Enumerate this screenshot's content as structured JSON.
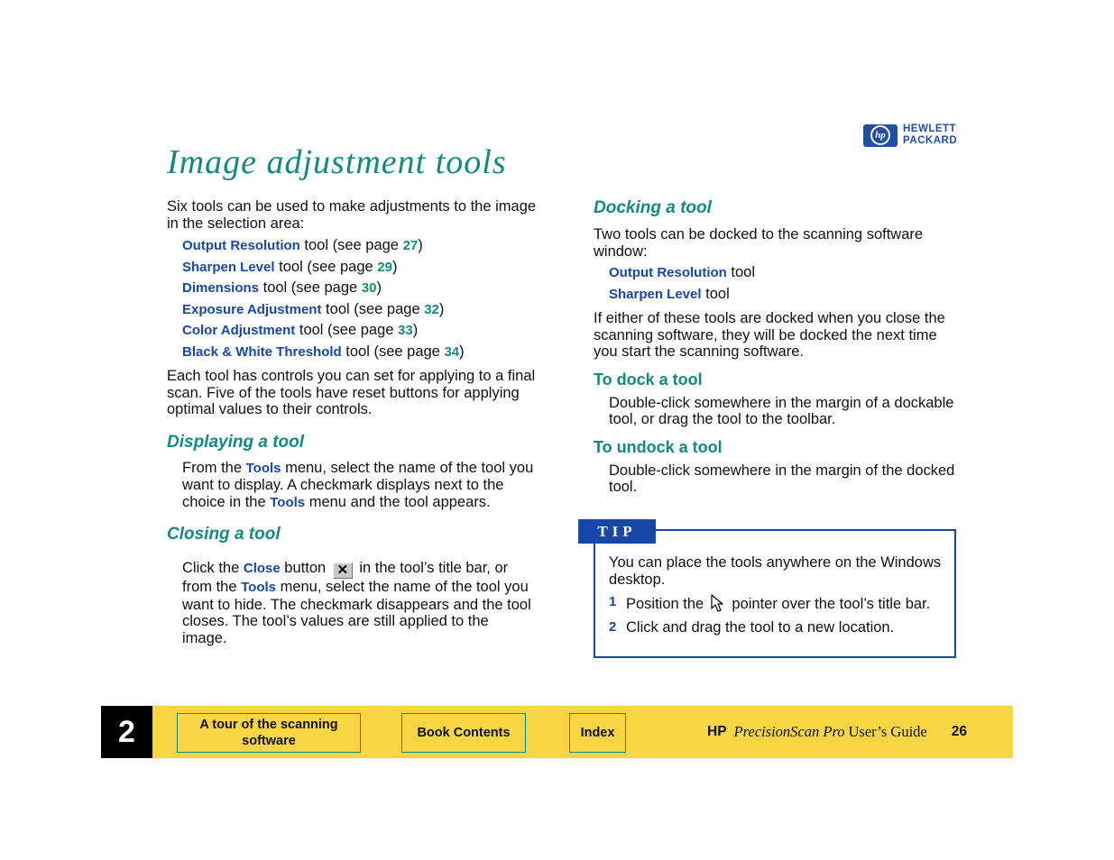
{
  "logo": {
    "mark": "hp",
    "line1": "HEWLETT",
    "line2": "PACKARD",
    "brand_color": "#1e50a8"
  },
  "title": "Image adjustment tools",
  "colors": {
    "heading": "#138a80",
    "link": "#1847a8",
    "footer_bg": "#f7d543",
    "tip_blue": "#1847a8"
  },
  "left": {
    "intro": "Six tools can be used to make adjustments to the image in the selection area:",
    "tools": [
      {
        "name": "Output Resolution",
        "mid": " tool (see page ",
        "page": "27",
        "end": ")"
      },
      {
        "name": "Sharpen Level",
        "mid": " tool (see page ",
        "page": "29",
        "end": ")"
      },
      {
        "name": "Dimensions",
        "mid": " tool (see page ",
        "page": "30",
        "end": ")"
      },
      {
        "name": "Exposure Adjustment",
        "mid": " tool (see page ",
        "page": "32",
        "end": ")"
      },
      {
        "name": "Color Adjustment",
        "mid": " tool (see page ",
        "page": "33",
        "end": ")"
      },
      {
        "name": "Black & White Threshold",
        "mid": " tool (see page ",
        "page": "34",
        "end": ")"
      }
    ],
    "controls_para": "Each tool has controls you can set for applying to a final scan. Five of the tools have reset buttons for applying optimal values to their controls.",
    "displaying": {
      "heading": "Displaying a tool",
      "t1": "From the ",
      "link1": "Tools",
      "t2": " menu, select the name of the tool you want to display. A checkmark displays next to the choice in the ",
      "link2": "Tools",
      "t3": " menu and the tool appears."
    },
    "closing": {
      "heading": "Closing a tool",
      "t1": "Click the ",
      "link1": "Close",
      "t2": " button ",
      "close_glyph": "✕",
      "t3": " in the tool’s title bar, or from the ",
      "link2": "Tools",
      "t4": " menu, select the name of the tool you want to hide. The checkmark disappears and the tool closes. The tool’s values are still applied to the image."
    }
  },
  "right": {
    "docking": {
      "heading": "Docking a tool",
      "intro": "Two tools can be docked to the scanning software window:",
      "tools": [
        {
          "name": "Output Resolution",
          "suffix": " tool"
        },
        {
          "name": "Sharpen Level",
          "suffix": " tool"
        }
      ],
      "para": "If either of these tools are docked when you close the scanning software, they will be docked the next time you start the scanning software."
    },
    "dock": {
      "heading": "To dock a tool",
      "text": "Double-click somewhere in the margin of a dockable tool, or drag the tool to the toolbar."
    },
    "undock": {
      "heading": "To undock a tool",
      "text": "Double-click somewhere in the margin of the docked tool."
    },
    "tip": {
      "label": "TIP",
      "intro": "You can place the tools anywhere on the Windows desktop.",
      "steps": [
        {
          "num": "1",
          "t1": "Position the ",
          "t2": " pointer over the tool’s title bar."
        },
        {
          "num": "2",
          "t1": "Click and drag the tool to a new location.",
          "t2": ""
        }
      ]
    }
  },
  "footer": {
    "chapter": "2",
    "buttons": [
      "A tour of the scanning software",
      "Book Contents",
      "Index"
    ],
    "hp": "HP",
    "product": "PrecisionScan Pro",
    "guide": "User’s Guide",
    "page": "26"
  }
}
